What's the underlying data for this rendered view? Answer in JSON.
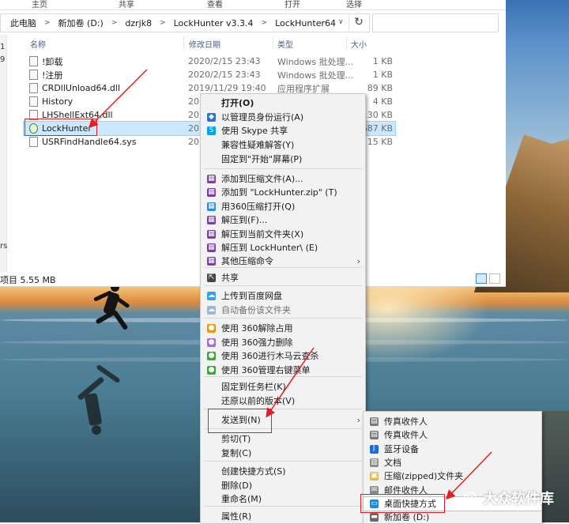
{
  "ribbon": {
    "tabs": [
      "主页",
      "共享",
      "查看",
      "打开",
      "选择"
    ]
  },
  "address": {
    "breadcrumbs": [
      "此电脑",
      "新加卷 (D:)",
      "dzrjk8",
      "LockHunter v3.3.4",
      "LockHunter64"
    ]
  },
  "nav_fragments": [
    "1",
    "9",
    "rs"
  ],
  "columns": {
    "name": "名称",
    "date": "修改日期",
    "type": "类型",
    "size": "大小"
  },
  "files": [
    {
      "name": "!卸载",
      "date": "2020/2/15 23:43",
      "type": "Windows 批处理...",
      "size": "1 KB"
    },
    {
      "name": "!注册",
      "date": "2020/2/15 23:43",
      "type": "Windows 批处理...",
      "size": "1 KB"
    },
    {
      "name": "CRDllUnload64.dll",
      "date": "2019/11/29 19:40",
      "type": "应用程序扩展",
      "size": "89 KB"
    },
    {
      "name": "History",
      "date": "20",
      "type": "",
      "size": "4 KB"
    },
    {
      "name": "LHShellExt64.dll",
      "date": "20",
      "type": "",
      "size": "130 KB"
    },
    {
      "name": "LockHunter",
      "date": "20",
      "type": "",
      "size": "687 KB"
    },
    {
      "name": "USRFindHandle64.sys",
      "date": "20",
      "type": "",
      "size": "15 KB"
    }
  ],
  "status": {
    "text": "项目 5.55 MB"
  },
  "context_menu": {
    "items": [
      {
        "label": "打开(O)",
        "icon": "",
        "icon_color": ""
      },
      {
        "label": "以管理员身份运行(A)",
        "icon": "uac-shield-icon",
        "icon_color": "#2f6fc4"
      },
      {
        "label": "使用 Skype 共享",
        "icon": "skype-icon",
        "icon_color": "#00a2ed"
      },
      {
        "label": "兼容性疑难解答(Y)",
        "icon": "",
        "icon_color": ""
      },
      {
        "label": "固定到\"开始\"屏幕(P)",
        "icon": "",
        "icon_color": ""
      },
      {
        "label": "添加到压缩文件(A)...",
        "icon": "winrar-icon",
        "icon_color": "#7b3fa0"
      },
      {
        "label": "添加到 \"LockHunter.zip\" (T)",
        "icon": "winrar-icon",
        "icon_color": "#7b3fa0"
      },
      {
        "label": "用360压缩打开(Q)",
        "icon": "zip360-icon",
        "icon_color": "#2c8ad6"
      },
      {
        "label": "解压到(F)...",
        "icon": "winrar-icon",
        "icon_color": "#7b3fa0"
      },
      {
        "label": "解压到当前文件夹(X)",
        "icon": "winrar-icon",
        "icon_color": "#7b3fa0"
      },
      {
        "label": "解压到 LockHunter\\ (E)",
        "icon": "winrar-icon",
        "icon_color": "#7b3fa0"
      },
      {
        "label": "其他压缩命令",
        "icon": "winrar-icon",
        "icon_color": "#7b3fa0"
      },
      {
        "label": "共享",
        "icon": "share-icon",
        "icon_color": "#444444"
      },
      {
        "label": "上传到百度网盘",
        "icon": "baidu-cloud-icon",
        "icon_color": "#3aa0e8"
      },
      {
        "label": "自动备份该文件夹",
        "icon": "baidu-cloud-icon",
        "icon_color": "#9ab8d6"
      },
      {
        "label": "使用 360解除占用",
        "icon": "unlock360-icon",
        "icon_color": "#e39a14"
      },
      {
        "label": "使用 360强力删除",
        "icon": "delete360-icon",
        "icon_color": "#a070d0"
      },
      {
        "label": "使用 360进行木马云查杀",
        "icon": "scan360-icon",
        "icon_color": "#3aa83a"
      },
      {
        "label": "使用 360管理右键菜单",
        "icon": "menu360-icon",
        "icon_color": "#3aa83a"
      },
      {
        "label": "固定到任务栏(K)",
        "icon": "",
        "icon_color": ""
      },
      {
        "label": "还原以前的版本(V)",
        "icon": "",
        "icon_color": ""
      },
      {
        "label": "发送到(N)",
        "icon": "",
        "icon_color": ""
      },
      {
        "label": "剪切(T)",
        "icon": "",
        "icon_color": ""
      },
      {
        "label": "复制(C)",
        "icon": "",
        "icon_color": ""
      },
      {
        "label": "创建快捷方式(S)",
        "icon": "",
        "icon_color": ""
      },
      {
        "label": "删除(D)",
        "icon": "",
        "icon_color": ""
      },
      {
        "label": "重命名(M)",
        "icon": "",
        "icon_color": ""
      },
      {
        "label": "属性(R)",
        "icon": "",
        "icon_color": ""
      }
    ]
  },
  "sendto_menu": {
    "items": [
      {
        "label": "传真收件人",
        "icon": "fax-icon",
        "icon_color": "#7a7a7a"
      },
      {
        "label": "传真收件人",
        "icon": "fax-icon",
        "icon_color": "#7a7a7a"
      },
      {
        "label": "蓝牙设备",
        "icon": "bluetooth-icon",
        "icon_color": "#1670d6"
      },
      {
        "label": "文档",
        "icon": "documents-icon",
        "icon_color": "#8a8a8a"
      },
      {
        "label": "压缩(zipped)文件夹",
        "icon": "zip-folder-icon",
        "icon_color": "#e6b84a"
      },
      {
        "label": "邮件收件人",
        "icon": "mail-icon",
        "icon_color": "#8a8a8a"
      },
      {
        "label": "桌面快捷方式",
        "icon": "desktop-icon",
        "icon_color": "#1e88d8"
      },
      {
        "label": "新加卷 (D:)",
        "icon": "drive-icon",
        "icon_color": "#6a6a6a"
      }
    ]
  },
  "watermark": {
    "text": "大众软件库"
  },
  "colors": {
    "selection": "#cce8ff",
    "annotation_red": "#e21f26",
    "menu_bg": "#f2f2f2"
  }
}
